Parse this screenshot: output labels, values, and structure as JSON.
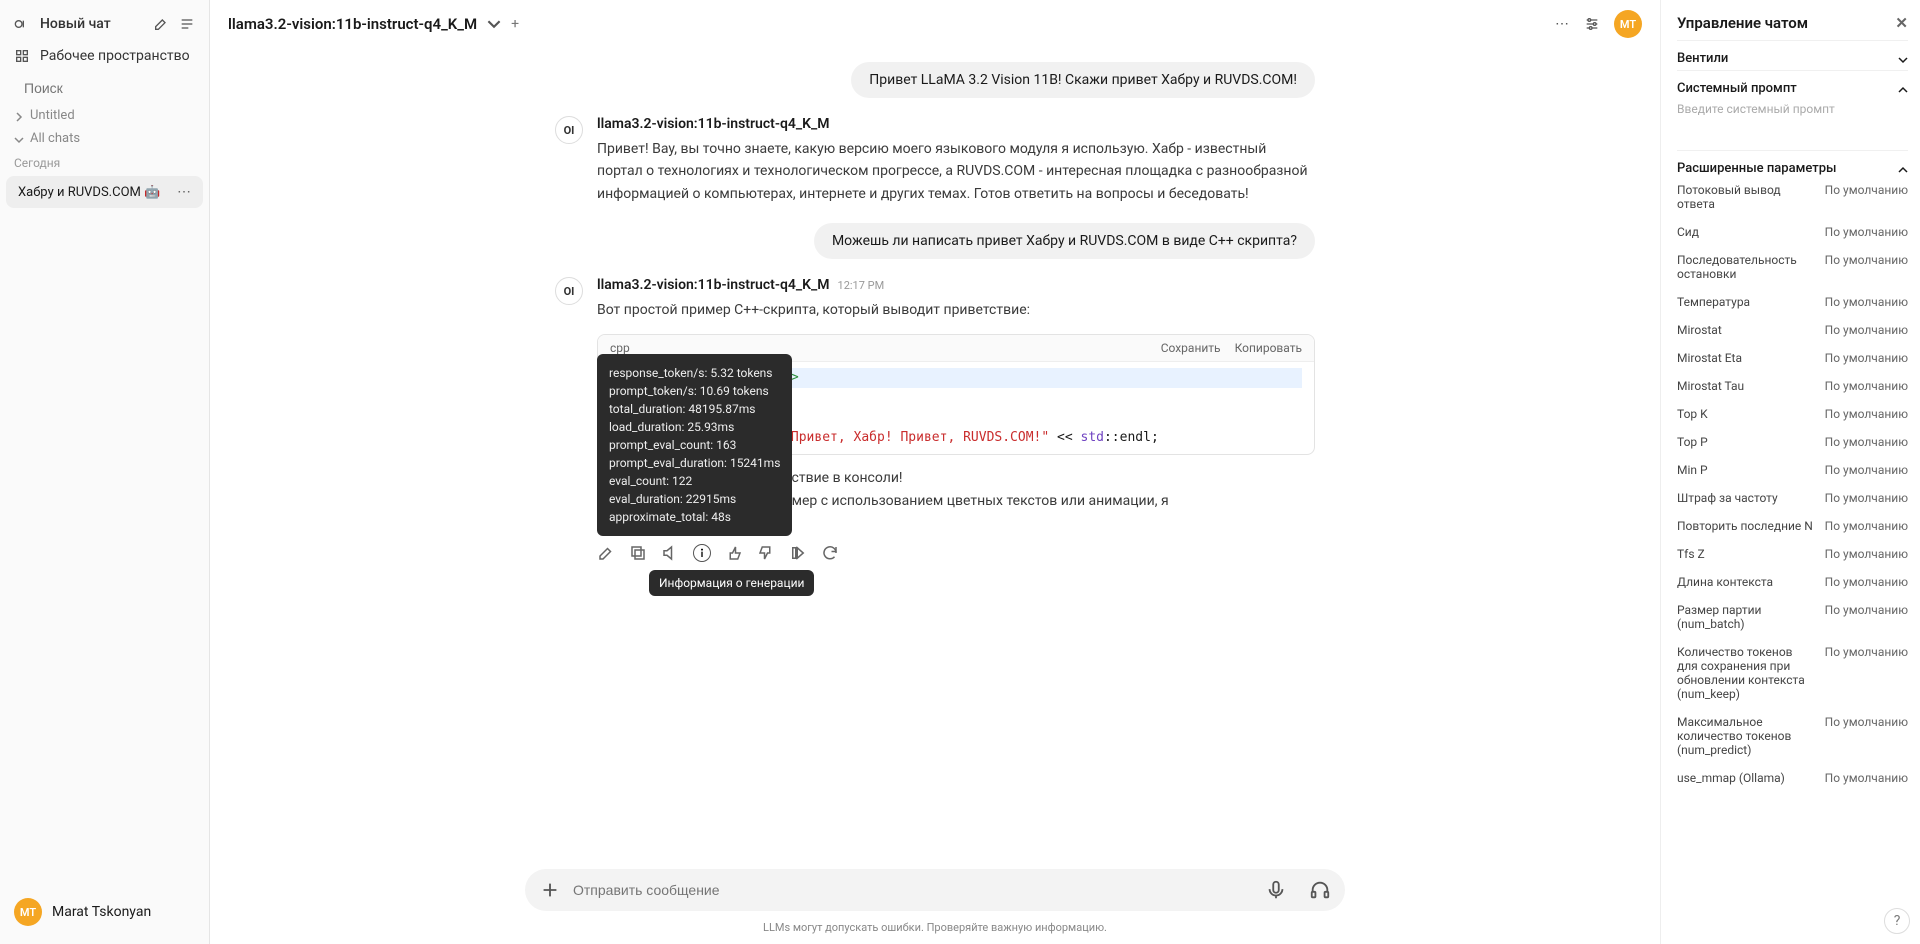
{
  "sidebar": {
    "new_chat": "Новый чат",
    "workspace": "Рабочее пространство",
    "search_placeholder": "Поиск",
    "tree": {
      "untitled": "Untitled",
      "all_chats": "All chats"
    },
    "section_today": "Сегодня",
    "active_chat": "Xaбрy и RUVDS.COM 🤖",
    "user_name": "Marat Tskonyan",
    "user_initials": "MT"
  },
  "topbar": {
    "model": "llama3.2-vision:11b-instruct-q4_K_M",
    "avatar_initials": "MT"
  },
  "chat": {
    "user1": "Привет LLaMA 3.2 Vision 11B! Скажи привет Хабру и RUVDS.COM!",
    "bot1_name": "llama3.2-vision:11b-instruct-q4_K_M",
    "bot1_text": "Привет! Вау, вы точно знаете, какую версию моего языкового модуля я использую. Хабр - известный портал о технологиях и технологическом прогрессе, а RUVDS.COM - интересная площадка с разнообразной информацией о компьютерах, интернете и других темах. Готов ответить на вопросы и беседовать!",
    "user2": "Можешь ли написать привет Хабру и RUVDS.COM в виде С++ скрипта?",
    "bot2_name": "llama3.2-vision:11b-instruct-q4_K_M",
    "bot2_time": "12:17 PM",
    "bot2_intro": "Вот простой пример С++-скрипта, который выводит приветствие:",
    "code_lang": "cpp",
    "code_save": "Сохранить",
    "code_copy": "Копировать",
    "bot2_after1": "устите, чтобы увидеть приветствие в консоли!",
    "bot2_after2": "это более интересным, например с использованием цветных текстов или анимации, я",
    "bot2_after3": "!)"
  },
  "tooltip": {
    "lines": [
      "response_token/s: 5.32 tokens",
      "prompt_token/s: 10.69 tokens",
      "total_duration: 48195.87ms",
      "load_duration: 25.93ms",
      "prompt_eval_count: 163",
      "prompt_eval_duration: 15241ms",
      "eval_count: 122",
      "eval_duration: 22915ms",
      "approximate_total: 48s"
    ],
    "label": "Информация о генерации"
  },
  "composer": {
    "placeholder": "Отправить сообщение"
  },
  "footer": "LLMs могут допускать ошибки. Проверяйте важную информацию.",
  "rightpanel": {
    "title": "Управление чатом",
    "valves": "Вентили",
    "sysprompt_head": "Системный промпт",
    "sysprompt_placeholder": "Введите системный промпт",
    "advanced_head": "Расширенные параметры",
    "default": "По умолчанию",
    "params": [
      "Потоковый вывод ответа",
      "Сид",
      "Последовательность остановки",
      "Температура",
      "Mirostat",
      "Mirostat Eta",
      "Mirostat Tau",
      "Top K",
      "Top P",
      "Min P",
      "Штраф за частоту",
      "Повторить последние N",
      "Tfs Z",
      "Длина контекста",
      "Размер партии (num_batch)",
      "Количество токенов для сохранения при обновлении контекста (num_keep)",
      "Максимальное количество токенов (num_predict)",
      "use_mmap (Ollama)"
    ]
  }
}
